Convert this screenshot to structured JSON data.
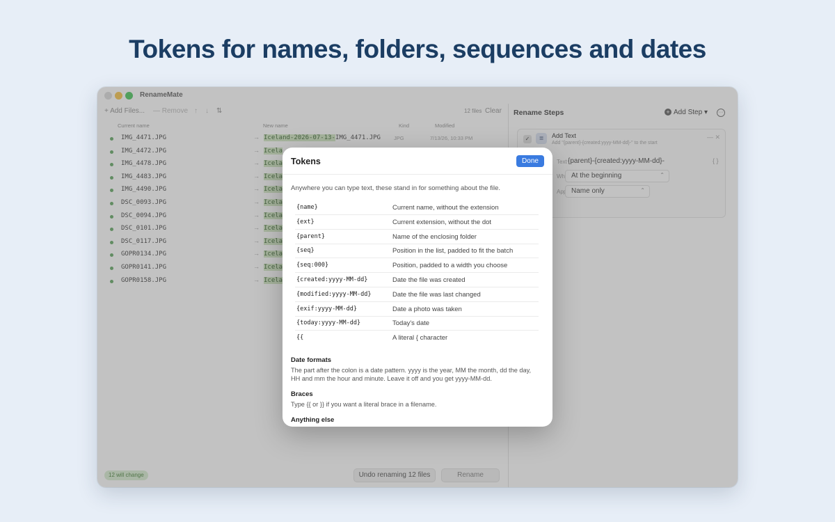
{
  "headline": "Tokens for names, folders, sequences and dates",
  "app": {
    "title": "RenameMate"
  },
  "toolbar": {
    "add_files": "+ Add Files...",
    "remove": "— Remove",
    "move_up": "↑",
    "move_down": "↓",
    "sort": "⇅",
    "file_count": "12 files",
    "clear": "Clear"
  },
  "table": {
    "columns": {
      "current": "Current name",
      "new": "New name",
      "kind": "Kind",
      "modified": "Modified"
    },
    "rows": [
      {
        "current": "IMG_4471.JPG",
        "new_prefix": "Iceland-2026-07-13-",
        "new_rest": "IMG_4471.JPG",
        "kind": "JPG",
        "modified": "7/13/26, 10:33 PM"
      },
      {
        "current": "IMG_4472.JPG",
        "new_prefix": "Icela"
      },
      {
        "current": "IMG_4478.JPG",
        "new_prefix": "Icela"
      },
      {
        "current": "IMG_4483.JPG",
        "new_prefix": "Icela"
      },
      {
        "current": "IMG_4490.JPG",
        "new_prefix": "Icela"
      },
      {
        "current": "DSC_0093.JPG",
        "new_prefix": "Icela"
      },
      {
        "current": "DSC_0094.JPG",
        "new_prefix": "Icela"
      },
      {
        "current": "DSC_0101.JPG",
        "new_prefix": "Icela"
      },
      {
        "current": "DSC_0117.JPG",
        "new_prefix": "Icela"
      },
      {
        "current": "GOPR0134.JPG",
        "new_prefix": "Icela"
      },
      {
        "current": "GOPR0141.JPG",
        "new_prefix": "Icela"
      },
      {
        "current": "GOPR0158.JPG",
        "new_prefix": "Icela"
      }
    ]
  },
  "footer": {
    "badge": "12 will change",
    "undo": "Undo renaming 12 files",
    "rename": "Rename"
  },
  "steps_panel": {
    "title": "Rename Steps",
    "add_step": "Add Step",
    "step": {
      "name": "Add Text",
      "desc": "Add \"{parent}-{created:yyyy-MM-dd}-\" to the start",
      "text_label": "Text",
      "text_value": "{parent}-{created:yyyy-MM-dd}-",
      "where_label": "Where",
      "where_value": "At the beginning",
      "apply_label": "Apply to",
      "apply_value": "Name only"
    }
  },
  "sheet": {
    "title": "Tokens",
    "done": "Done",
    "intro": "Anywhere you can type text, these stand in for something about the file.",
    "tokens": [
      {
        "code": "{name}",
        "desc": "Current name, without the extension"
      },
      {
        "code": "{ext}",
        "desc": "Current extension, without the dot"
      },
      {
        "code": "{parent}",
        "desc": "Name of the enclosing folder"
      },
      {
        "code": "{seq}",
        "desc": "Position in the list, padded to fit the batch"
      },
      {
        "code": "{seq:000}",
        "desc": "Position, padded to a width you choose"
      },
      {
        "code": "{created:yyyy-MM-dd}",
        "desc": "Date the file was created"
      },
      {
        "code": "{modified:yyyy-MM-dd}",
        "desc": "Date the file was last changed"
      },
      {
        "code": "{exif:yyyy-MM-dd}",
        "desc": "Date a photo was taken"
      },
      {
        "code": "{today:yyyy-MM-dd}",
        "desc": "Today's date"
      },
      {
        "code": "{{",
        "desc": "A literal { character"
      }
    ],
    "date_formats_title": "Date formats",
    "date_formats_body": "The part after the colon is a date pattern. yyyy is the year, MM the month, dd the day, HH and mm the hour and minute. Leave it off and you get yyyy-MM-dd.",
    "braces_title": "Braces",
    "braces_body": "Type {{ or }} if you want a literal brace in a filename.",
    "anything_else_title": "Anything else"
  },
  "colors": {
    "accent": "#3a7be0",
    "headline": "#1b3d63",
    "highlight": "#cde6be",
    "status_dot": "#59a35a"
  }
}
